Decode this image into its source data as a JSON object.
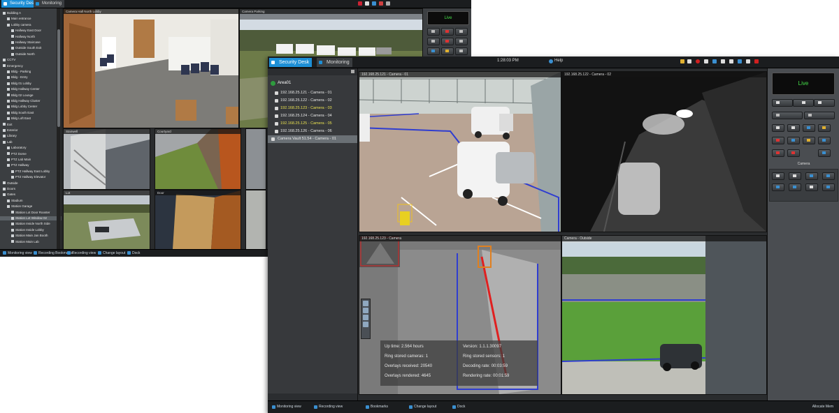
{
  "back_window": {
    "tabs": [
      {
        "label": "Security Desk",
        "active": true
      },
      {
        "label": "Monitoring",
        "active": false
      }
    ],
    "tree": [
      {
        "label": "Building A",
        "level": 0
      },
      {
        "label": "Main entrance",
        "level": 1
      },
      {
        "label": "Lobby camera",
        "level": 1
      },
      {
        "label": "Hallway East Door",
        "level": 2
      },
      {
        "label": "Hallway North",
        "level": 2
      },
      {
        "label": "Hallway Staircase",
        "level": 2
      },
      {
        "label": "Outside South Exit",
        "level": 2
      },
      {
        "label": "Outside North",
        "level": 2
      },
      {
        "label": "CCTV",
        "level": 0
      },
      {
        "label": "Emergency",
        "level": 0
      },
      {
        "label": "Bldg - Parking",
        "level": 1
      },
      {
        "label": "Bldg - Entry",
        "level": 1
      },
      {
        "label": "Bldg 01 Lobby",
        "level": 1
      },
      {
        "label": "Bldg Hallway Center",
        "level": 1
      },
      {
        "label": "Bldg 02 Lounge",
        "level": 1
      },
      {
        "label": "Bldg Hallway Cluster",
        "level": 1
      },
      {
        "label": "Bldg Lobby Center",
        "level": 1
      },
      {
        "label": "Bldg South East",
        "level": 1
      },
      {
        "label": "Bldg Loft East",
        "level": 1
      },
      {
        "label": "Exit",
        "level": 0
      },
      {
        "label": "Exterior",
        "level": 0
      },
      {
        "label": "Library",
        "level": 0
      },
      {
        "label": "Lab",
        "level": 0
      },
      {
        "label": "Laboratory",
        "level": 1
      },
      {
        "label": "PTZ Dome",
        "level": 1
      },
      {
        "label": "PTZ Lab Main",
        "level": 1
      },
      {
        "label": "PTZ Hallway",
        "level": 1
      },
      {
        "label": "PTZ Hallway East Lobby",
        "level": 2
      },
      {
        "label": "PTZ Hallway Elevator",
        "level": 2
      },
      {
        "label": "Outside",
        "level": 0
      },
      {
        "label": "Doors",
        "level": 0
      },
      {
        "label": "Gates",
        "level": 0
      },
      {
        "label": "Stadium",
        "level": 1
      },
      {
        "label": "Station Garage",
        "level": 1
      },
      {
        "label": "Station Lot Door Rooster",
        "level": 2
      },
      {
        "label": "Station Lot Window 02",
        "level": 2
      },
      {
        "label": "Station Inside North Side",
        "level": 2
      },
      {
        "label": "Station Inside Lobby",
        "level": 2
      },
      {
        "label": "Station Main Jan Booth",
        "level": 2
      },
      {
        "label": "Station Main Lab",
        "level": 2
      }
    ],
    "selected_tree_index": 35,
    "bottom_items": [
      "Monitoring view",
      "Recording Bookmarks",
      "Recording view",
      "Change layout",
      "Dock"
    ],
    "live_label": "Live"
  },
  "front_window": {
    "tabs": [
      {
        "label": "Security Desk",
        "active": true
      },
      {
        "label": "Monitoring",
        "active": false
      }
    ],
    "toolbar_text": "1:28:03 PM",
    "help_label": "Help",
    "tree_root": "Area01",
    "cameras": [
      {
        "label": "192.168.25.121 - Camera - 01",
        "color": "#e8e8e8"
      },
      {
        "label": "192.168.25.122 - Camera - 02",
        "color": "#e8e8e8"
      },
      {
        "label": "192.168.25.123 - Camera - 03",
        "color": "#e8e050"
      },
      {
        "label": "192.168.25.124 - Camera - 04",
        "color": "#e8e8e8"
      },
      {
        "label": "192.168.25.125 - Camera - 05",
        "color": "#e8e050"
      },
      {
        "label": "192.168.25.126 - Camera - 06",
        "color": "#e8e8e8"
      },
      {
        "label": "Camera Vault 51.54 - Camera - 01",
        "color": "#e8e8e8"
      }
    ],
    "selected_camera_index": 6,
    "tiles": [
      {
        "label": "192.168.25.121 - Camera - 01"
      },
      {
        "label": "192.168.25.122 - Camera - 02"
      },
      {
        "label": "192.168.25.123 - Camera"
      },
      {
        "label": "Camera - Outside"
      }
    ],
    "stats": [
      {
        "key": "Up time:",
        "value": "2.564 hours"
      },
      {
        "key": "Version:",
        "value": "1.1.1.30097"
      },
      {
        "key": "Ring stored cameras:",
        "value": "1"
      },
      {
        "key": "Ring stored sensors:",
        "value": "1"
      },
      {
        "key": "Overlays received:",
        "value": "20540"
      },
      {
        "key": "Decoding rate:",
        "value": "00:03:59"
      },
      {
        "key": "Overlays rendered:",
        "value": "4645"
      },
      {
        "key": "Rendering rate:",
        "value": "00:01:59"
      }
    ],
    "live_label": "Live",
    "panel_label": "Camera",
    "bottom_items": [
      "Monitoring view",
      "Recording view",
      "Bookmarks",
      "Change layout",
      "Dock"
    ],
    "status_right": "Allocate Mem"
  },
  "colors": {
    "accent": "#1d8fd6",
    "live": "#45e04a",
    "overlay_blue": "#2f3dd0",
    "overlay_red": "#e02020",
    "detection": "#f0c020"
  }
}
